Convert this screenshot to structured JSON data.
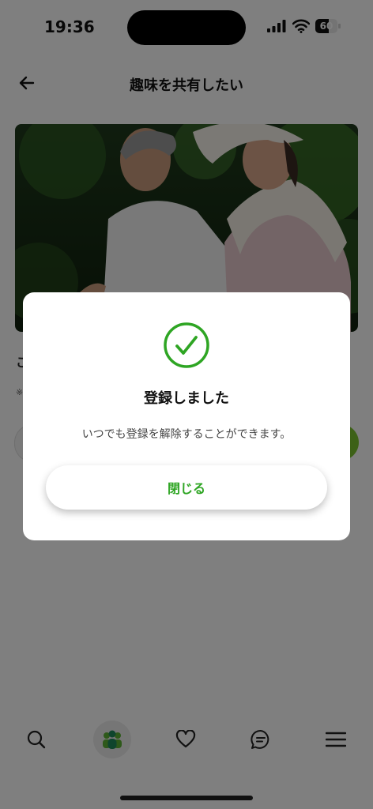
{
  "status_bar": {
    "time": "19:36",
    "battery_level": "60",
    "battery_fraction": 0.6
  },
  "header": {
    "title": "趣味を共有したい",
    "back_icon": "arrow-left-icon"
  },
  "hero": {
    "image": "couple-jogging-photo"
  },
  "background_content": {
    "heading_peek": "こ",
    "note_peek": "※"
  },
  "nav": {
    "items": [
      {
        "icon": "search-icon"
      },
      {
        "icon": "people-group-icon",
        "active": true
      },
      {
        "icon": "heart-icon"
      },
      {
        "icon": "chat-bubble-icon"
      },
      {
        "icon": "hamburger-menu-icon"
      }
    ]
  },
  "modal": {
    "icon": "check-circle-icon",
    "title": "登録しました",
    "message": "いつでも登録を解除することができます。",
    "close_label": "閉じる"
  },
  "colors": {
    "accent_green": "#2ea523",
    "light_green": "#7bc32e",
    "overlay": "rgba(0,0,0,0.5)"
  }
}
